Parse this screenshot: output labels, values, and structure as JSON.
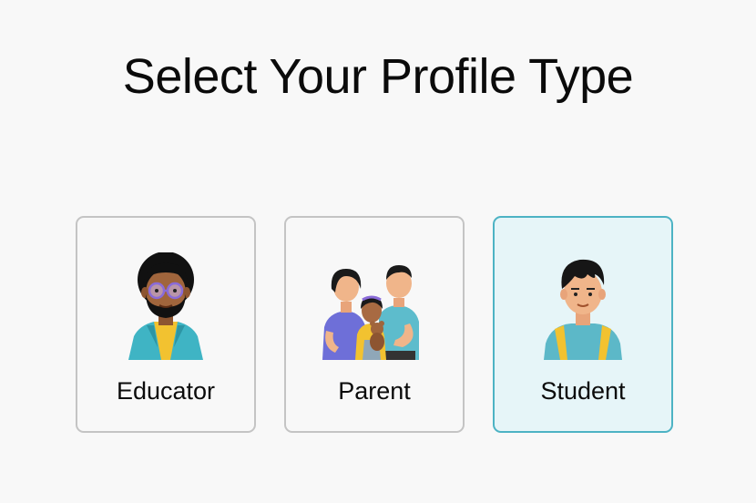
{
  "page": {
    "title": "Select Your Profile Type"
  },
  "profiles": [
    {
      "label": "Educator",
      "icon": "educator-avatar-icon",
      "selected": false
    },
    {
      "label": "Parent",
      "icon": "family-avatar-icon",
      "selected": false
    },
    {
      "label": "Student",
      "icon": "student-avatar-icon",
      "selected": true
    }
  ],
  "colors": {
    "background": "#f8f8f8",
    "card_border": "#c4c4c4",
    "selected_border": "#4db3c4",
    "selected_background": "#e6f5f8",
    "text": "#0b0b0b"
  }
}
